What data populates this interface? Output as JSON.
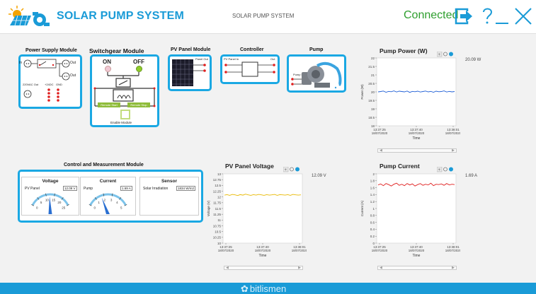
{
  "header": {
    "app_title": "SOLAR PUMP SYSTEM",
    "center_title": "SOLAR PUMP SYSTEM",
    "connection_status": "Connected",
    "status_color": "#2e9e2e",
    "accent_color": "#1a9bd7"
  },
  "footer": {
    "brand": "bitlismen"
  },
  "modules": {
    "power_supply": {
      "title": "Power Supply Module",
      "in_label": "In",
      "out_label_1": "Out",
      "out_label_2": "Out",
      "ac_out_label": "220VAC Out",
      "dc_label": "+24DC",
      "gnd_label": "GND"
    },
    "switchgear": {
      "title": "Switchgear Module",
      "on_label": "ON",
      "off_label": "OFF",
      "remote_start": "Remote Start",
      "remote_stop": "Remote Stop",
      "enable_label": "Enable Module"
    },
    "pv_panel": {
      "title": "PV Panel Module",
      "out_label": "Panel Out"
    },
    "controller": {
      "title": "Controller",
      "in_label": "PV Panel In",
      "out_label": "Out"
    },
    "pump": {
      "title": "Pump",
      "in_label": "Pump In"
    }
  },
  "control": {
    "title": "Control and Measurement Module",
    "voltage": {
      "title": "Voltage",
      "label": "PV Panel",
      "value": "12.09 V",
      "ticks": [
        "0",
        "5",
        "10",
        "15",
        "20",
        "25"
      ],
      "needle": 12.09,
      "max": 25
    },
    "current": {
      "title": "Current",
      "label": "Pump",
      "value": "1.69 A",
      "ticks": [
        "0",
        "1",
        "2",
        "3",
        "4",
        "5"
      ],
      "needle": 1.69,
      "max": 5
    },
    "sensor": {
      "title": "Sensor",
      "label": "Solar Irradiation",
      "value": "1834 W/m2"
    }
  },
  "chart_data": [
    {
      "id": "pump_power",
      "type": "line",
      "title": "Pump Power (W)",
      "reading": "20.09 W",
      "ylabel": "Power (W)",
      "xlabel": "Time",
      "ylim": [
        18,
        22
      ],
      "yticks": [
        "22",
        "21.5",
        "21",
        "20.5",
        "20",
        "19.5",
        "19",
        "18.5",
        "18"
      ],
      "xticks": [
        [
          "13:37:25",
          "18/07/2020"
        ],
        [
          "13:37:40",
          "18/07/2020"
        ],
        [
          "13:38:01",
          "18/07/2020"
        ]
      ],
      "series": [
        {
          "values": [
            20.0,
            20.02,
            20.05,
            19.98,
            20.03,
            20.01,
            20.06,
            19.99,
            20.04,
            20.02,
            20.0,
            20.05,
            19.97,
            20.03,
            20.01,
            20.04,
            19.99,
            20.02,
            20.05,
            20.0,
            20.03,
            19.98,
            20.04,
            20.01,
            20.02,
            20.06,
            19.99,
            20.03,
            20.0,
            20.02
          ],
          "color": "#1f5fd6"
        }
      ]
    },
    {
      "id": "pv_voltage",
      "type": "line",
      "title": "PV Panel Voltage",
      "reading": "12.09 V",
      "ylabel": "Voltage (V)",
      "xlabel": "Time",
      "ylim": [
        10,
        13
      ],
      "yticks": [
        "13",
        "12.75",
        "12.5",
        "12.25",
        "12",
        "11.75",
        "11.5",
        "11.25",
        "11",
        "10.75",
        "10.5",
        "10.25",
        "10"
      ],
      "xticks": [
        [
          "13:37:25",
          "18/07/2020"
        ],
        [
          "13:37:40",
          "18/07/2020"
        ],
        [
          "13:38:01",
          "18/07/2020"
        ]
      ],
      "series": [
        {
          "values": [
            12.08,
            12.1,
            12.07,
            12.11,
            12.09,
            12.06,
            12.1,
            12.08,
            12.12,
            12.09,
            12.07,
            12.1,
            12.08,
            12.11,
            12.09,
            12.07,
            12.1,
            12.08,
            12.09,
            12.11,
            12.07,
            12.1,
            12.09,
            12.08,
            12.1,
            12.07,
            12.11,
            12.09,
            12.08,
            12.09
          ],
          "color": "#e8b800"
        }
      ]
    },
    {
      "id": "pump_current",
      "type": "line",
      "title": "Pump Current",
      "reading": "1.69 A",
      "ylabel": "Current (A)",
      "xlabel": "Time",
      "ylim": [
        0,
        2
      ],
      "yticks": [
        "2",
        "1.8",
        "1.6",
        "1.4",
        "1.2",
        "1",
        "0.8",
        "0.6",
        "0.4",
        "0.2",
        "0"
      ],
      "xticks": [
        [
          "13:37:25",
          "18/07/2020"
        ],
        [
          "13:37:40",
          "18/07/2020"
        ],
        [
          "13:38:01",
          "18/07/2020"
        ]
      ],
      "series": [
        {
          "values": [
            1.68,
            1.71,
            1.66,
            1.72,
            1.69,
            1.65,
            1.7,
            1.73,
            1.67,
            1.7,
            1.66,
            1.72,
            1.68,
            1.71,
            1.65,
            1.69,
            1.72,
            1.67,
            1.7,
            1.68,
            1.73,
            1.66,
            1.7,
            1.69,
            1.71,
            1.67,
            1.72,
            1.68,
            1.7,
            1.69
          ],
          "color": "#e02020"
        }
      ]
    }
  ]
}
